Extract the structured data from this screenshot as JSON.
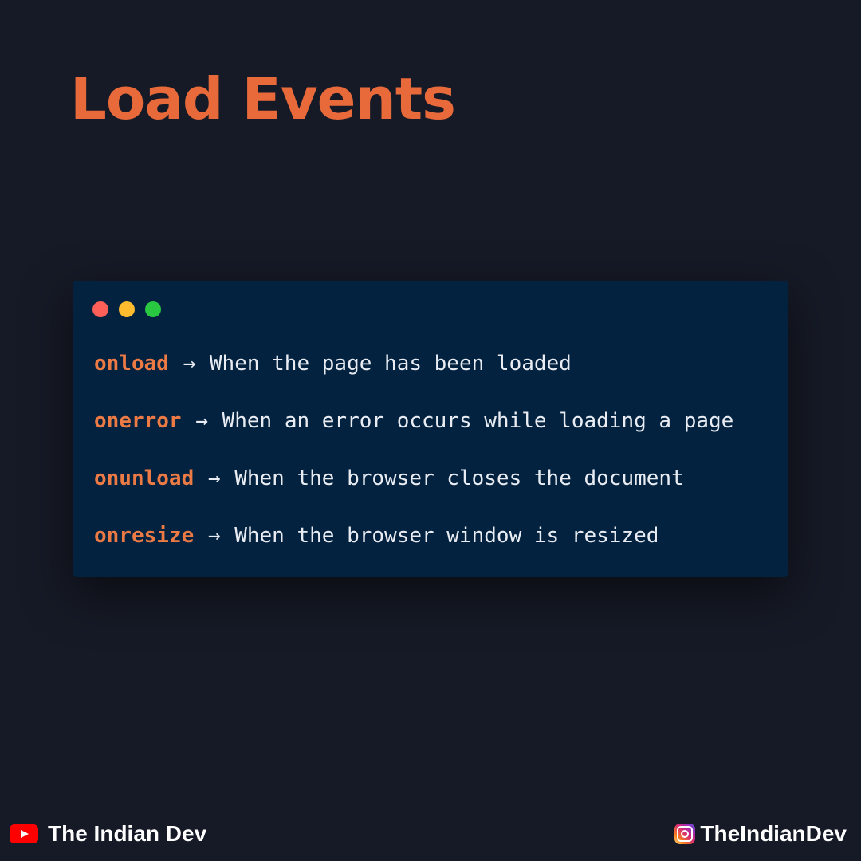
{
  "page": {
    "title": "Load Events",
    "background_color": "#161a26",
    "accent_color": "#e8693a"
  },
  "code_window": {
    "background_color": "#03223f",
    "window_controls": [
      {
        "name": "close-dot",
        "color": "#fe5f58"
      },
      {
        "name": "minimize-dot",
        "color": "#febc2e"
      },
      {
        "name": "maximize-dot",
        "color": "#29c840"
      }
    ],
    "lines": [
      {
        "keyword": "onload",
        "arrow": "→",
        "description": "When the page has been loaded"
      },
      {
        "keyword": "onerror",
        "arrow": "→",
        "description": "When an error occurs while loading a page"
      },
      {
        "keyword": "onunload",
        "arrow": "→",
        "description": "When the browser closes the document"
      },
      {
        "keyword": "onresize",
        "arrow": "→",
        "description": "When the browser window is resized"
      }
    ]
  },
  "footer": {
    "youtube": {
      "icon": "youtube-icon",
      "label": "The Indian Dev"
    },
    "instagram": {
      "icon": "instagram-icon",
      "label": "TheIndianDev"
    }
  }
}
